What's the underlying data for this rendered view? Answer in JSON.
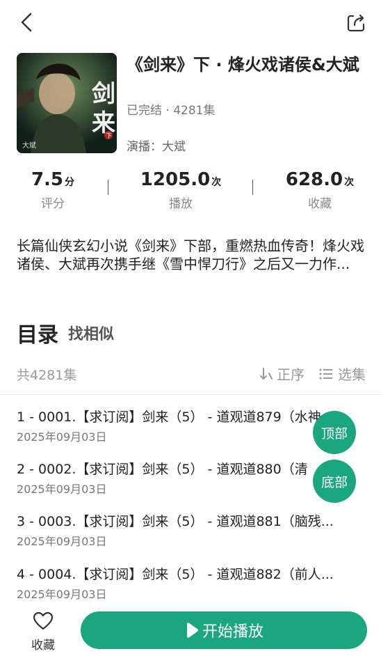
{
  "header": {
    "back_icon": "chevron-left-icon",
    "share_icon": "share-icon"
  },
  "book": {
    "cover_text": "剑来",
    "cover_badge": "下",
    "cover_author": "大斌",
    "title": "《剑来》下 · 烽火戏诸侯&大斌",
    "status": "已完结 · 4281集",
    "narrator": "演播：大斌"
  },
  "stats": [
    {
      "value": "7.5",
      "unit": "分",
      "label": "评分"
    },
    {
      "value": "1205.0",
      "unit": "次",
      "label": "播放"
    },
    {
      "value": "628.0",
      "unit": "次",
      "label": "收藏"
    }
  ],
  "description": "长篇仙侠玄幻小说《剑来》下部，重燃热血传奇！烽火戏诸侯、大斌再次携手继《雪中悍刀行》之后又一力作...",
  "catalog": {
    "title": "目录",
    "similar": "找相似",
    "count": "共4281集",
    "sort_label": "正序",
    "select_label": "选集"
  },
  "episodes": [
    {
      "title": "1 - 0001.【求订阅】剑来（5） - 道观道879（水神",
      "date": "2025年09月03日"
    },
    {
      "title": "2 - 0002.【求订阅】剑来（5） - 道观道880（清",
      "date": "2025年09月03日"
    },
    {
      "title": "3 - 0003.【求订阅】剑来（5） - 道观道881（脑残...",
      "date": "2025年09月03日"
    },
    {
      "title": "4 - 0004.【求订阅】剑来（5） - 道观道882（前人...",
      "date": "2025年09月03日"
    }
  ],
  "floating": {
    "top_label": "顶部",
    "bottom_label": "底部"
  },
  "bottom_bar": {
    "favorite_label": "收藏",
    "play_label": "开始播放"
  },
  "colors": {
    "accent": "#1aa77e"
  }
}
